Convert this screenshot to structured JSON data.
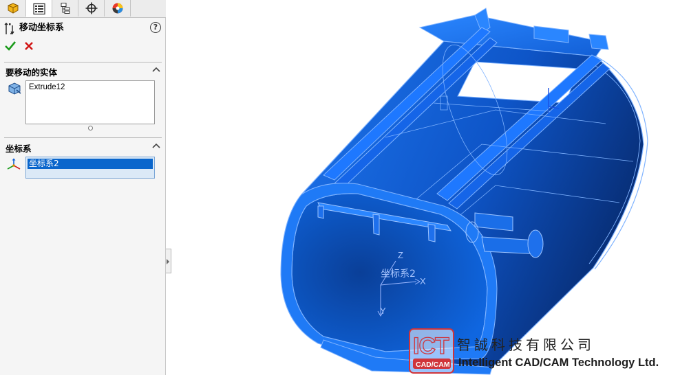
{
  "panel": {
    "tabs": [
      {
        "icon": "feature-manager-icon"
      },
      {
        "icon": "property-manager-icon"
      },
      {
        "icon": "configuration-manager-icon"
      },
      {
        "icon": "dimxpert-icon"
      },
      {
        "icon": "display-manager-icon"
      }
    ],
    "active_tab": 1,
    "title": "移动坐标系",
    "help_symbol": "?",
    "sections": {
      "bodies": {
        "label": "要移动的实体",
        "items": [
          "Extrude12"
        ]
      },
      "coord": {
        "label": "坐标系",
        "selected": "坐标系2"
      }
    }
  },
  "viewport": {
    "triad": {
      "z": "Z",
      "x": "X",
      "y": "Y",
      "name": "坐标系2"
    }
  },
  "watermark": {
    "logo_letters": "ICT",
    "logo_sub": "CAD/CAM",
    "company_cn": "智誠科技有限公司",
    "company_en": "Intelligent CAD/CAM Technology Ltd."
  },
  "colors": {
    "model_blue": "#1565e8",
    "edge_blue": "#7fb3ff",
    "selection": "#0a66cc",
    "ok_green": "#1a9a1a",
    "cancel_red": "#d01010",
    "logo_red": "#d0343a"
  }
}
